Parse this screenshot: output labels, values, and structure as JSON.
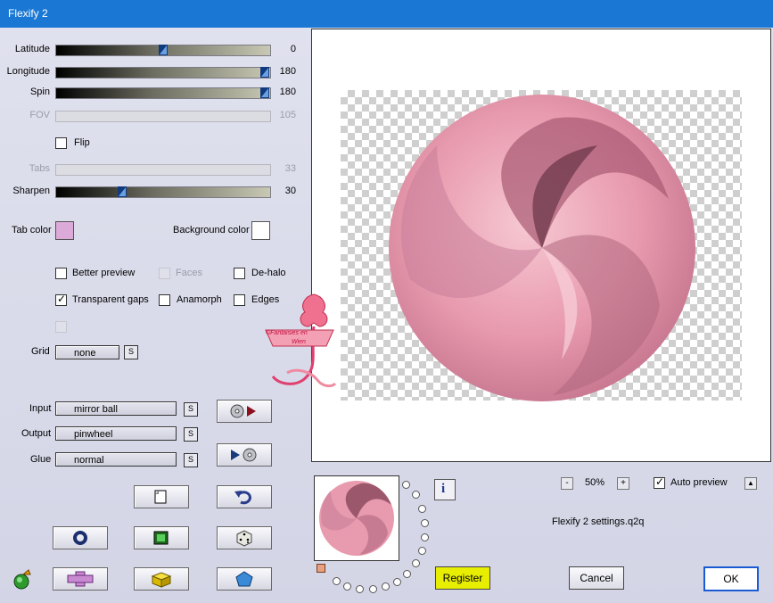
{
  "window": {
    "title": "Flexify 2"
  },
  "sliders": [
    {
      "id": "latitude",
      "label": "Latitude",
      "value": "0",
      "fraction": 0.5,
      "enabled": true
    },
    {
      "id": "longitude",
      "label": "Longitude",
      "value": "180",
      "fraction": 1.0,
      "enabled": true
    },
    {
      "id": "spin",
      "label": "Spin",
      "value": "180",
      "fraction": 1.0,
      "enabled": true
    },
    {
      "id": "fov",
      "label": "FOV",
      "value": "105",
      "fraction": null,
      "enabled": false
    },
    {
      "id": "tabs",
      "label": "Tabs",
      "value": "33",
      "fraction": null,
      "enabled": false
    },
    {
      "id": "sharpen",
      "label": "Sharpen",
      "value": "30",
      "fraction": 0.3,
      "enabled": true
    }
  ],
  "flip": {
    "label": "Flip",
    "checked": false
  },
  "colors": {
    "tab_label": "Tab color",
    "tab_value": "#dcaad8",
    "bg_label": "Background color",
    "bg_value": "#ffffff",
    "titlebar": "#1a78d4",
    "register": "#e8ee00"
  },
  "options": {
    "better_preview": "Better preview",
    "faces": "Faces",
    "de_halo": "De-halo",
    "transparent_gaps": "Transparent gaps",
    "anamorph": "Anamorph",
    "edges": "Edges"
  },
  "grid": {
    "label": "Grid",
    "value": "none",
    "s": "S"
  },
  "io": {
    "input_label": "Input",
    "input_value": "mirror ball",
    "output_label": "Output",
    "output_value": "pinwheel",
    "glue_label": "Glue",
    "glue_value": "normal",
    "s": "S"
  },
  "zoom": {
    "minus": "-",
    "value": "50%",
    "plus": "+"
  },
  "auto_preview": {
    "label": "Auto preview",
    "checked": true,
    "arrow": "▲"
  },
  "settings_file": "Flexify 2 settings.q2q",
  "buttons": {
    "register": "Register",
    "cancel": "Cancel",
    "ok": "OK",
    "info": "i"
  },
  "watermark": {
    "line1": "©Fantaisies en",
    "line2": "Wien"
  }
}
